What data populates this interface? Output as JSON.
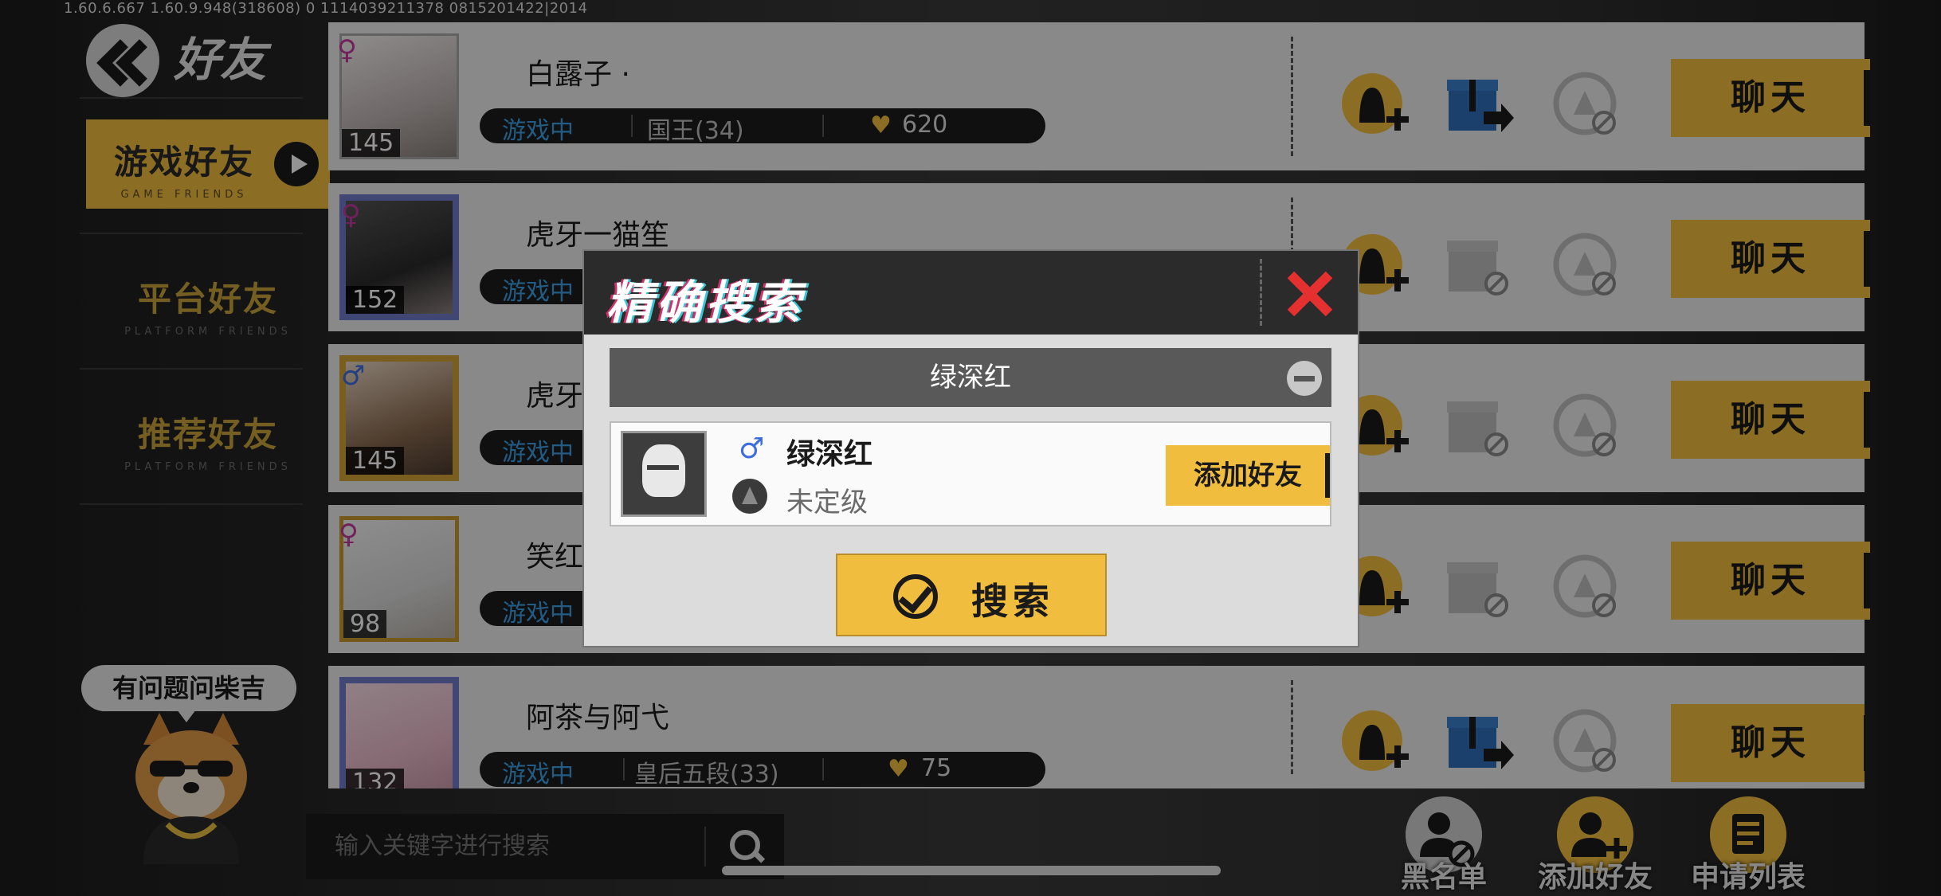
{
  "version_line": "1.60.6.667  1.60.9.948(318608)  0  1114039211378    0815201422|2014",
  "nav": {
    "title": "好友",
    "items": [
      {
        "cn": "游戏好友",
        "en": "GAME FRIENDS"
      },
      {
        "cn": "平台好友",
        "en": "PLATFORM FRIENDS"
      },
      {
        "cn": "推荐好友",
        "en": "PLATFORM FRIENDS"
      }
    ]
  },
  "friends": [
    {
      "name": "白露子 ·",
      "level": "145",
      "gender": "♀",
      "status": "游戏中",
      "rank": "国王(34)",
      "points": "620"
    },
    {
      "name": "虎牙一猫笙",
      "level": "152",
      "gender": "♀",
      "status": "游戏中"
    },
    {
      "name": "虎牙",
      "level": "145",
      "gender": "♂",
      "status": "游戏中"
    },
    {
      "name": "笑红",
      "level": "98",
      "gender": "♀",
      "status": "游戏中"
    },
    {
      "name": "阿茶与阿弋",
      "level": "132",
      "gender": "",
      "status": "游戏中",
      "rank": "皇后五段(33)",
      "points": "75"
    }
  ],
  "chat_label": "聊天",
  "modal": {
    "title": "精确搜索",
    "query": "绿深红",
    "result": {
      "gender": "♂",
      "name": "绿深红",
      "rank": "未定级",
      "add_label": "添加好友"
    },
    "search_label": "搜索"
  },
  "mascot": {
    "bubble": "有问题问柴吉"
  },
  "bottom": {
    "keyword_placeholder": "输入关键字进行搜索",
    "blacklist": "黑名单",
    "add_friend": "添加好友",
    "requests": "申请列表"
  },
  "colors": {
    "accent": "#f0bd3f",
    "status_blue": "#3b9fe6",
    "close_red": "#e53030",
    "female": "#c13a9e",
    "male": "#3f6de0"
  }
}
